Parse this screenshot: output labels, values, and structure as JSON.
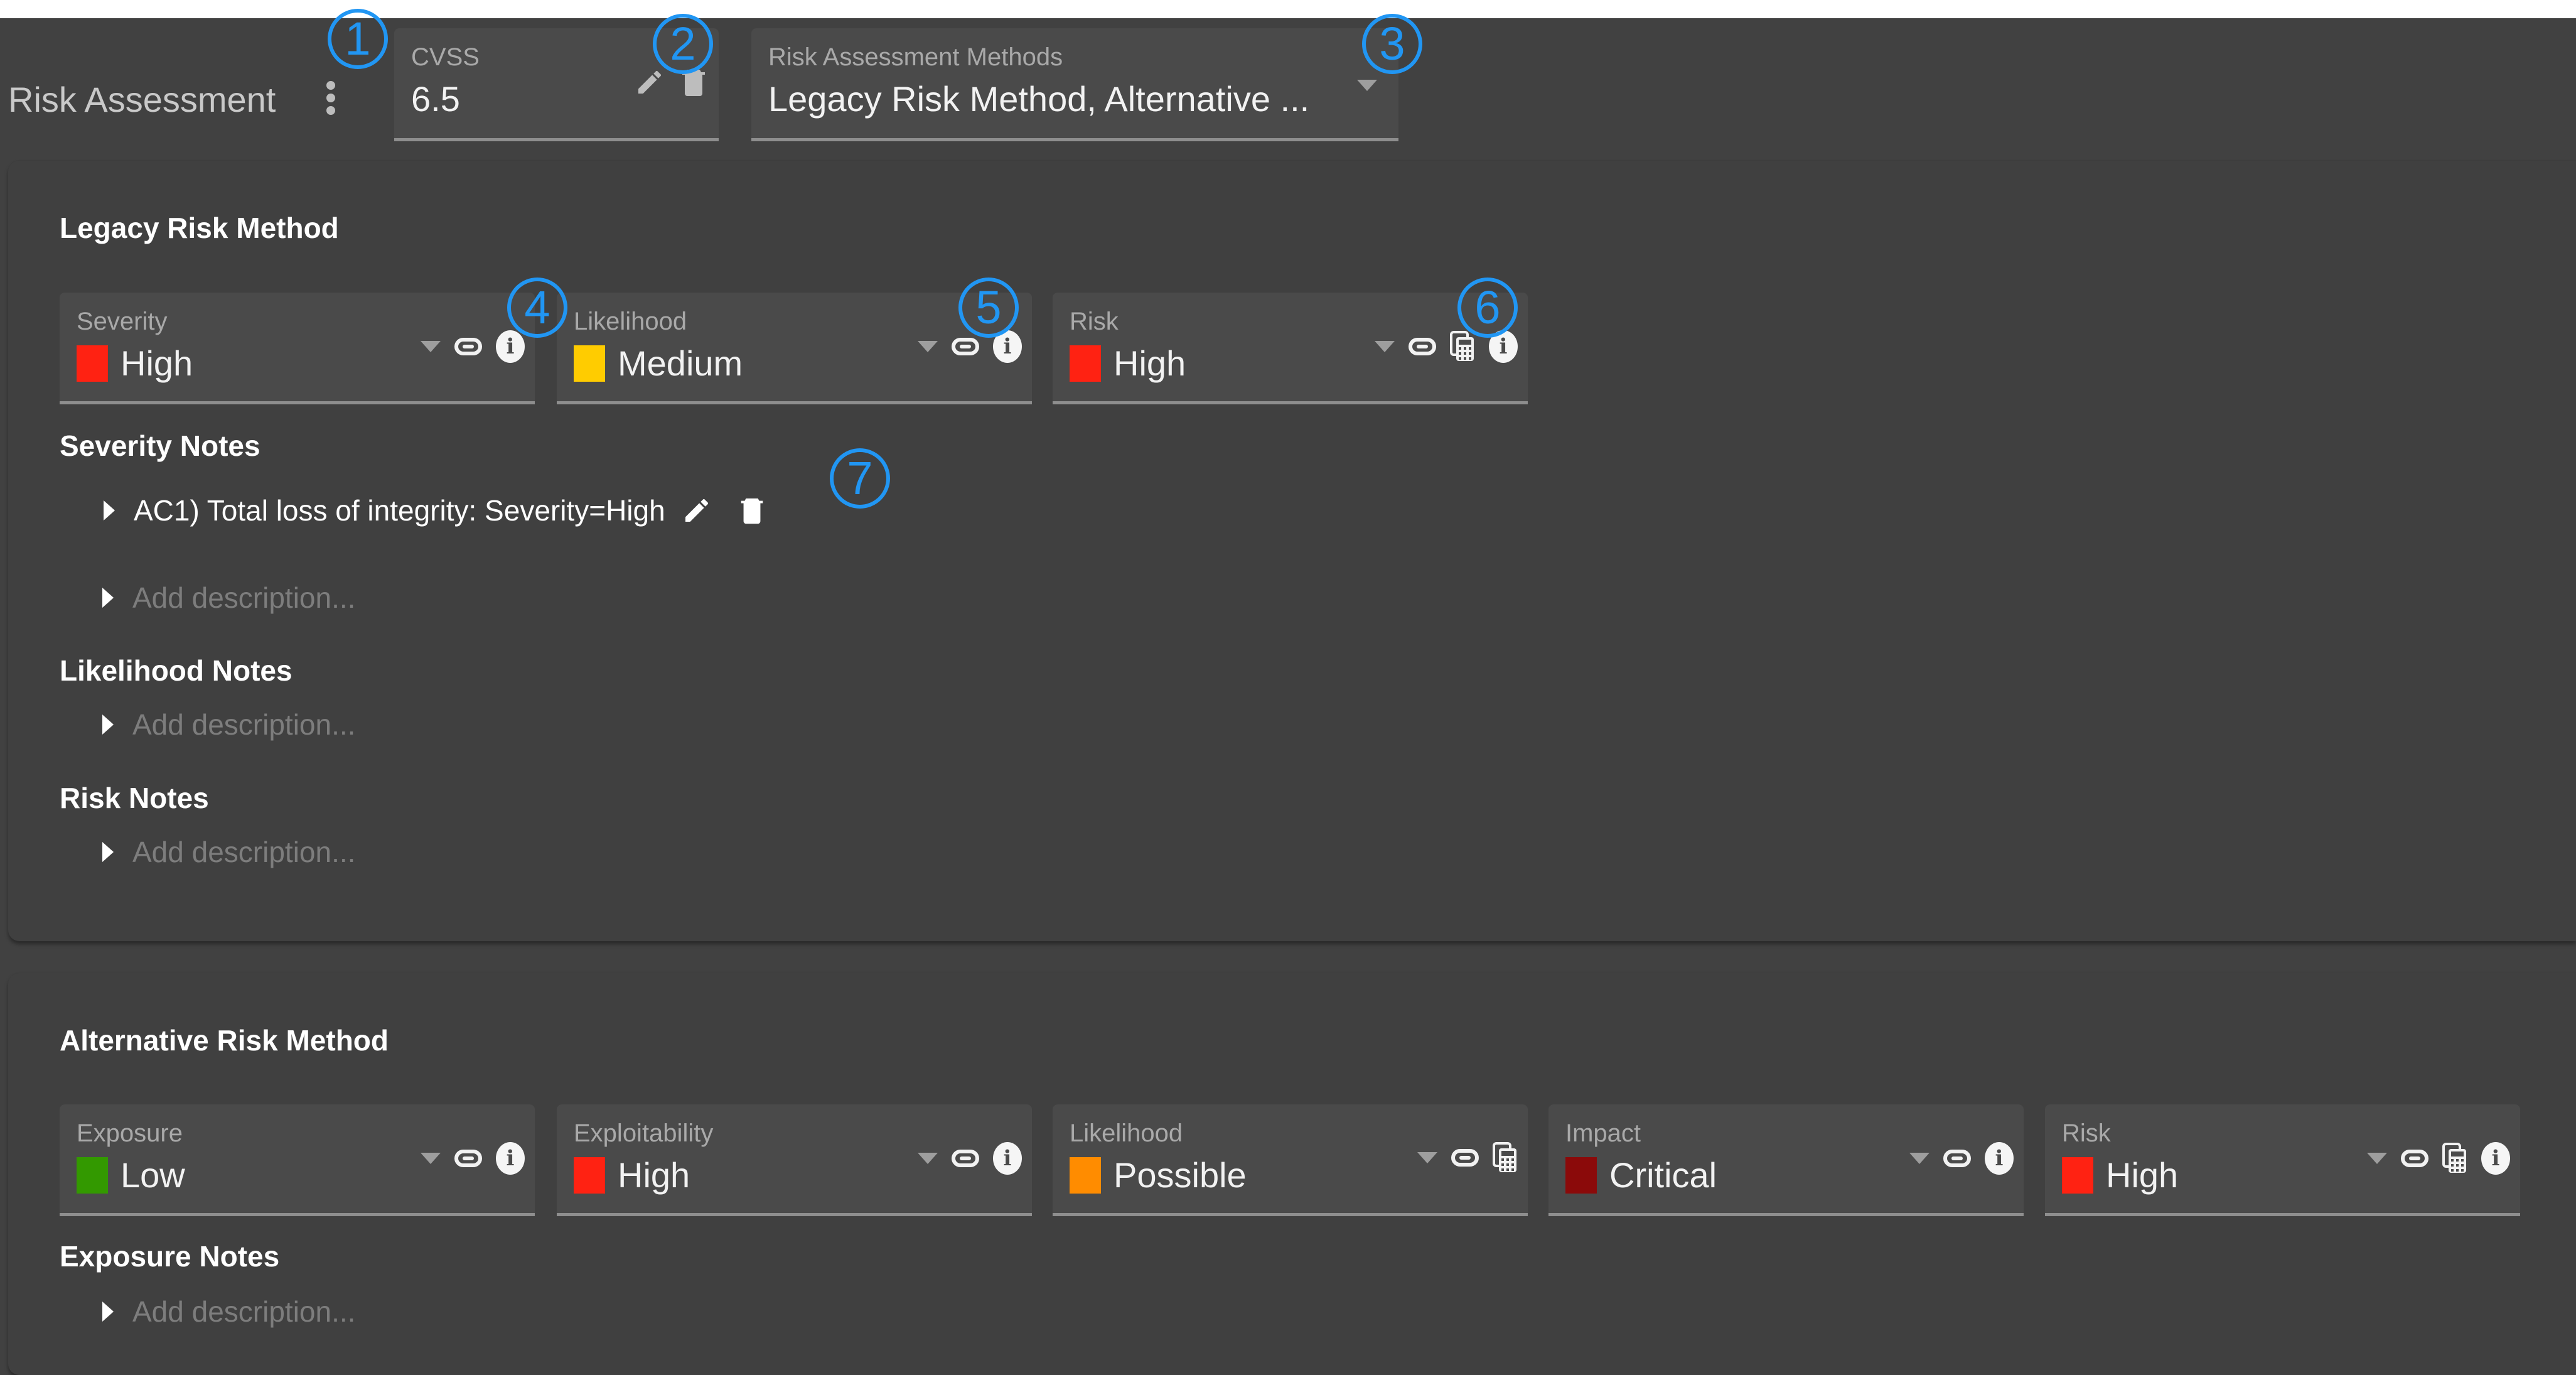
{
  "header": {
    "title": "Risk Assessment",
    "menu_icon": "more-vert-icon"
  },
  "cvss": {
    "label": "CVSS",
    "value": "6.5",
    "icons": [
      "edit-icon",
      "delete-icon"
    ]
  },
  "methods": {
    "label": "Risk Assessment Methods",
    "value": "Legacy Risk Method, Alternative ..."
  },
  "legacy": {
    "title": "Legacy Risk Method",
    "fields": [
      {
        "label": "Severity",
        "value": "High",
        "color": "#ff2212",
        "icons": [
          "dropdown-icon",
          "link-icon",
          "info-icon"
        ]
      },
      {
        "label": "Likelihood",
        "value": "Medium",
        "color": "#ffcc00",
        "icons": [
          "dropdown-icon",
          "link-icon",
          "info-icon"
        ]
      },
      {
        "label": "Risk",
        "value": "High",
        "color": "#ff2212",
        "icons": [
          "dropdown-icon",
          "link-icon",
          "calculator-icon",
          "info-icon"
        ]
      }
    ],
    "severity_notes": {
      "title": "Severity Notes",
      "items": [
        {
          "text": "AC1) Total loss of integrity: Severity=High"
        }
      ],
      "placeholder": "Add description..."
    },
    "likelihood_notes": {
      "title": "Likelihood Notes",
      "placeholder": "Add description..."
    },
    "risk_notes": {
      "title": "Risk Notes",
      "placeholder": "Add description..."
    }
  },
  "alternative": {
    "title": "Alternative Risk Method",
    "fields": [
      {
        "label": "Exposure",
        "value": "Low",
        "color": "#339900",
        "icons": [
          "dropdown-icon",
          "link-icon",
          "info-icon"
        ]
      },
      {
        "label": "Exploitability",
        "value": "High",
        "color": "#ff2212",
        "icons": [
          "dropdown-icon",
          "link-icon",
          "info-icon"
        ]
      },
      {
        "label": "Likelihood",
        "value": "Possible",
        "color": "#ff8c00",
        "icons": [
          "dropdown-icon",
          "link-icon",
          "calculator-icon"
        ]
      },
      {
        "label": "Impact",
        "value": "Critical",
        "color": "#8b0a0a",
        "icons": [
          "dropdown-icon",
          "link-icon",
          "info-icon"
        ]
      },
      {
        "label": "Risk",
        "value": "High",
        "color": "#ff2212",
        "icons": [
          "dropdown-icon",
          "link-icon",
          "calculator-icon",
          "info-icon"
        ]
      }
    ],
    "exposure_notes": {
      "title": "Exposure Notes",
      "placeholder": "Add description..."
    }
  },
  "callouts": [
    "1",
    "2",
    "3",
    "4",
    "5",
    "6",
    "7"
  ],
  "colors": {
    "callout": "#2196f3",
    "background": "#414141",
    "field": "#4a4a4a"
  }
}
